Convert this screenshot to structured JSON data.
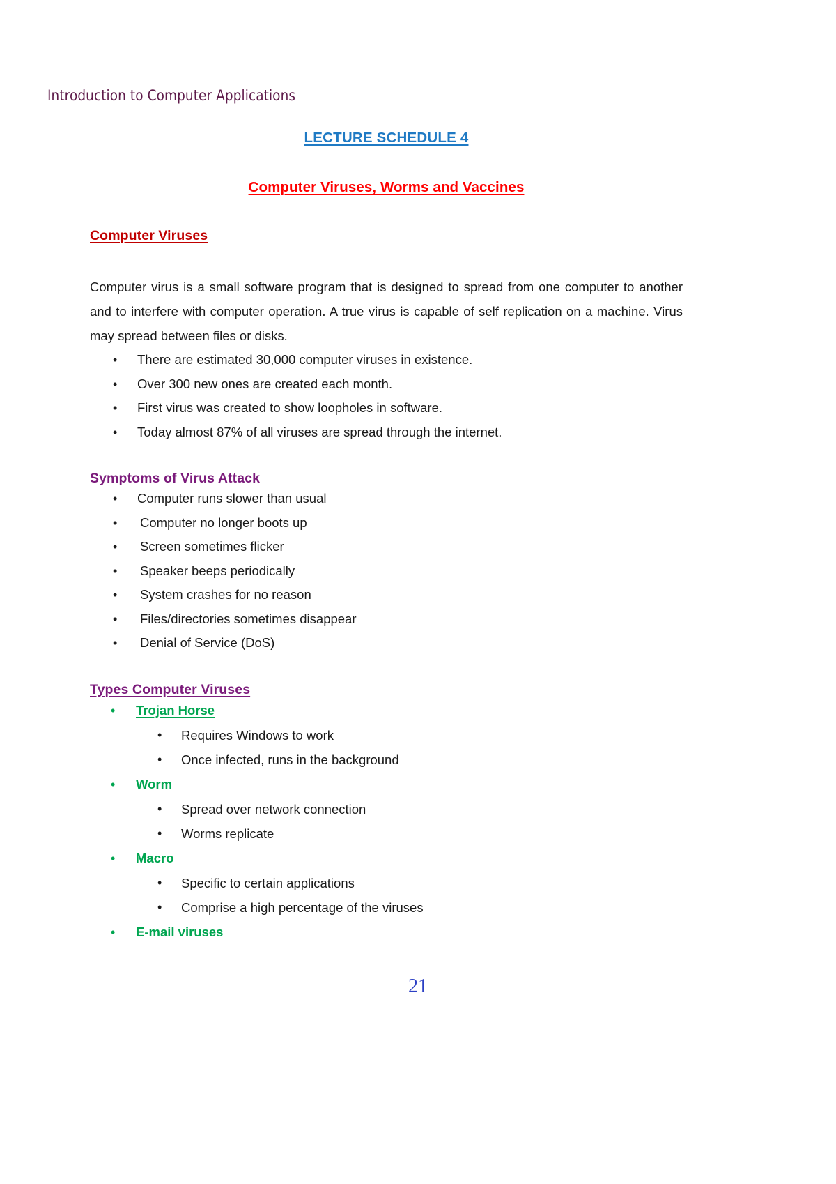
{
  "document": {
    "running_header": "Introduction to Computer Applications",
    "page_number": "21"
  },
  "titles": {
    "lecture_title": "LECTURE SCHEDULE 4",
    "lecture_subtitle": "Computer Viruses, Worms and Vaccines"
  },
  "sections": {
    "computer_viruses": {
      "heading": "Computer Viruses",
      "paragraph": "Computer virus is a small software program that is designed to spread from one computer to another and to interfere with computer operation. A true virus is capable of self replication on a machine. Virus may spread between files or disks.",
      "bullets": [
        "There are estimated 30,000 computer viruses in existence.",
        "Over 300 new ones are created each month.",
        "First virus was created to show loopholes in software.",
        "Today almost 87% of all viruses are spread through the internet."
      ]
    },
    "symptoms": {
      "heading": "Symptoms of Virus Attack",
      "bullets": [
        "Computer runs slower than usual",
        "Computer no longer boots up",
        "Screen sometimes flicker",
        "Speaker beeps periodically",
        "System crashes for no reason",
        "Files/directories sometimes disappear",
        "Denial of Service (DoS)"
      ]
    },
    "types": {
      "heading": "Types Computer Viruses",
      "items": [
        {
          "label": "Trojan Horse",
          "details": [
            "Requires Windows to work",
            "Once infected, runs in the background"
          ]
        },
        {
          "label": "Worm",
          "details": [
            "Spread over network connection",
            "Worms replicate"
          ]
        },
        {
          "label": "Macro",
          "details": [
            "Specific to certain applications",
            "Comprise a high percentage of the viruses"
          ]
        },
        {
          "label": "E-mail viruses",
          "details": []
        }
      ]
    }
  },
  "glyphs": {
    "bullet": "•"
  },
  "colors": {
    "header_purple": "#5E1B4A",
    "title_blue": "#1F7AC4",
    "title_red": "#FF0000",
    "heading_dark_red": "#C00000",
    "heading_purple": "#7B1B7B",
    "type_green": "#00A550",
    "page_number_blue": "#2B3FC4"
  }
}
